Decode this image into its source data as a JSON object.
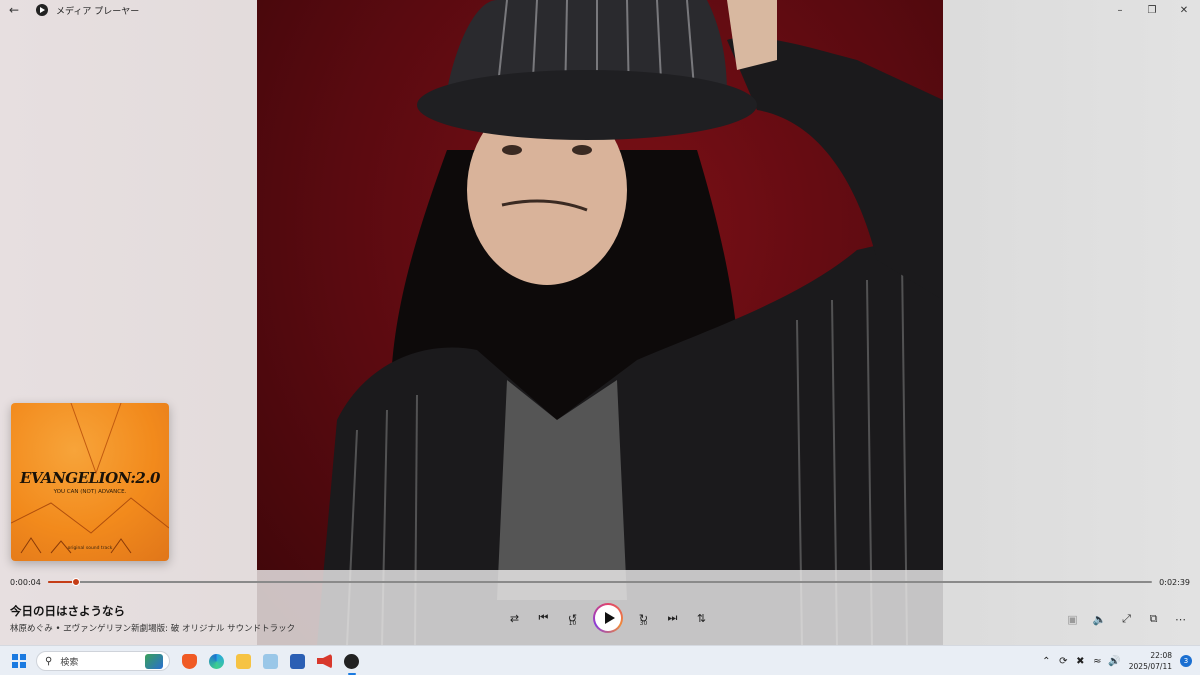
{
  "window": {
    "title": "メディア プレーヤー",
    "back_icon": "back-arrow-icon",
    "controls": [
      "minimize-icon",
      "restore-icon",
      "close-icon"
    ]
  },
  "album_art": {
    "title": "EVANGELION:2.0",
    "subtitle": "YOU CAN (NOT) ADVANCE.",
    "footer": "original sound track"
  },
  "playback": {
    "current_time": "0:00:04",
    "total_time": "0:02:39",
    "progress": 0.025
  },
  "now_playing": {
    "title": "今日の日はさようなら",
    "meta": "林原めぐみ • ヱヴァンゲリヲン新劇場版: 破 オリジナル サウンドトラック"
  },
  "transport": {
    "skip_back_label": "10",
    "skip_forward_label": "30",
    "buttons": [
      "shuffle-icon",
      "previous-icon",
      "skip-back-10-icon",
      "play-icon",
      "skip-forward-30-icon",
      "next-icon",
      "repeat-icon"
    ]
  },
  "right_controls": [
    "captions-icon",
    "volume-icon",
    "fullscreen-icon",
    "mini-player-icon",
    "more-icon"
  ],
  "taskbar": {
    "search_placeholder": "検索",
    "apps": [
      "brave-icon",
      "edge-icon",
      "file-explorer-icon",
      "media-icon",
      "word-icon",
      "speaker-app-icon",
      "media-player-icon"
    ],
    "time": "22:08",
    "date": "2025/07/11",
    "notification_count": "3"
  },
  "colors": {
    "accent": "#c53d16",
    "photo_bg": "#6a0c12",
    "album_orange": "#f28a1c",
    "taskbar_bg": "#e9eef5"
  }
}
